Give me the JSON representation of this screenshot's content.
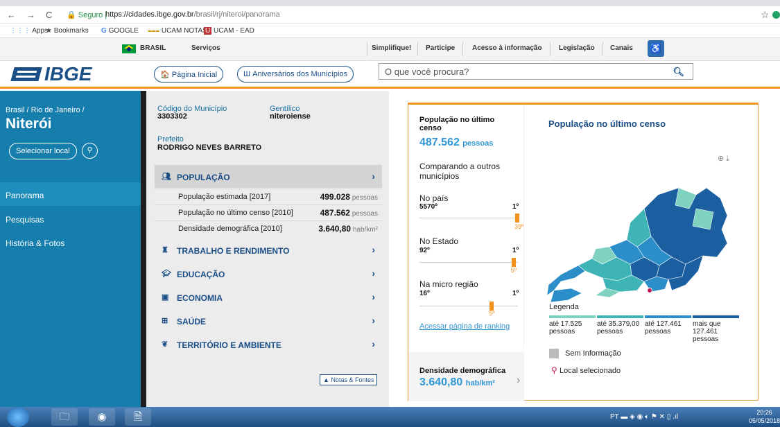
{
  "browser": {
    "back_icon": "←",
    "forward_icon": "→",
    "reload_icon": "C",
    "secure_label": "Seguro",
    "url_host": "https://cidades.ibge.gov.br",
    "url_path": "/brasil/rj/niteroi/panorama",
    "bookmarks": [
      "Apps",
      "Bookmarks",
      "GOOGLE",
      "UCAM NOTAS",
      "UCAM - EAD"
    ]
  },
  "govbar": {
    "country": "BRASIL",
    "servicos": "Serviços",
    "links": [
      "Simplifique!",
      "Participe",
      "Acesso à informação",
      "Legislação",
      "Canais"
    ]
  },
  "header": {
    "logo": "IBGE",
    "home_label": "Página Inicial",
    "anniv_label": "Aniversários dos Municípios",
    "search_placeholder": "O que você procura?"
  },
  "sidebar": {
    "breadcrumb": "Brasil / Rio de Janeiro /",
    "city": "Niterói",
    "select_label": "Selecionar local",
    "nav": [
      "Panorama",
      "Pesquisas",
      "História & Fotos"
    ]
  },
  "info": {
    "code_label": "Código do Município",
    "code_value": "3303302",
    "gentilico_label": "Gentílico",
    "gentilico_value": "niteroiense",
    "prefeito_label": "Prefeito",
    "prefeito_value": "RODRIGO NEVES BARRETO",
    "populacao_title": "POPULAÇÃO",
    "rows": [
      {
        "name": "População estimada [2017]",
        "value": "499.028",
        "unit": "pessoas"
      },
      {
        "name": "População no último censo [2010]",
        "value": "487.562",
        "unit": "pessoas"
      },
      {
        "name": "Densidade demográfica [2010]",
        "value": "3.640,80",
        "unit": "hab/km²"
      }
    ],
    "sections": [
      "TRABALHO E RENDIMENTO",
      "EDUCAÇÃO",
      "ECONOMIA",
      "SAÚDE",
      "TERRITÓRIO E AMBIENTE"
    ],
    "notas_label": "Notas & Fontes"
  },
  "stats": {
    "pop_title": "População no último censo",
    "pop_value": "487.562",
    "pop_unit": "pessoas",
    "compare_title": "Comparando a outros municípios",
    "ranks": [
      {
        "label": "No país",
        "left": "5570º",
        "right": "1º",
        "pos": "39º",
        "fraction": 0.993
      },
      {
        "label": "No Estado",
        "left": "92º",
        "right": "1º",
        "pos": "5º",
        "fraction": 0.956
      },
      {
        "label": "Na micro região",
        "left": "16º",
        "right": "1º",
        "pos": "5º",
        "fraction": 0.733
      }
    ],
    "ranking_link": "Acessar página de ranking",
    "dens_title": "Densidade demográfica",
    "dens_value": "3.640,80",
    "dens_unit": "hab/km²"
  },
  "map": {
    "title": "População no último censo",
    "legend_title": "Legenda",
    "legend": [
      {
        "label": "até 17.525 pessoas",
        "color": "#7fd1c0"
      },
      {
        "label": "até 35.379,00 pessoas",
        "color": "#3fb4b6"
      },
      {
        "label": "até 127.461 pessoas",
        "color": "#2c8ec8"
      },
      {
        "label": "mais que 127.461 pessoas",
        "color": "#1c5fa0"
      }
    ],
    "no_info": "Sem Informação",
    "selected": "Local selecionado"
  },
  "taskbar": {
    "lang": "PT",
    "time": "20:26",
    "date": "05/05/2018"
  },
  "colors": {
    "sidebar": "#167eac",
    "accent": "#f0921d",
    "brand": "#1a4e87"
  }
}
